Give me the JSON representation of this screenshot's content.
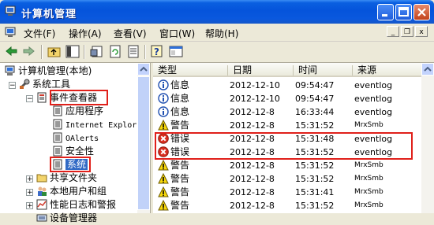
{
  "window": {
    "title": "计算机管理"
  },
  "menubar": {
    "items": [
      "文件(F)",
      "操作(A)",
      "查看(V)",
      "窗口(W)",
      "帮助(H)"
    ],
    "mdi_minimize": "_",
    "mdi_restore": "❐",
    "mdi_close": "x"
  },
  "toolbar": {
    "buttons": [
      "back-icon",
      "forward-icon",
      "up-folder-icon",
      "show-hide-tree-icon",
      "properties-icon",
      "refresh-icon",
      "export-list-icon",
      "help-icon",
      "console-icon"
    ]
  },
  "tree": {
    "items": [
      {
        "label": "计算机管理(本地)",
        "icon": "computer-icon"
      },
      {
        "label": "系统工具",
        "icon": "tools-icon"
      },
      {
        "label": "事件查看器",
        "icon": "event-viewer-icon"
      },
      {
        "label": "应用程序",
        "icon": "log-icon"
      },
      {
        "label": "Internet Explor",
        "icon": "log-icon"
      },
      {
        "label": "OAlerts",
        "icon": "log-icon"
      },
      {
        "label": "安全性",
        "icon": "log-icon"
      },
      {
        "label": "系统",
        "icon": "log-icon"
      },
      {
        "label": "共享文件夹",
        "icon": "folder-icon"
      },
      {
        "label": "本地用户和组",
        "icon": "users-icon"
      },
      {
        "label": "性能日志和警报",
        "icon": "perf-icon"
      },
      {
        "label": "设备管理器",
        "icon": "device-icon"
      }
    ]
  },
  "list": {
    "columns": [
      "类型",
      "日期",
      "时间",
      "来源"
    ],
    "rows": [
      {
        "type": "信息",
        "kind": "info",
        "date": "2012-12-10",
        "time": "09:54:47",
        "source": "eventlog"
      },
      {
        "type": "信息",
        "kind": "info",
        "date": "2012-12-10",
        "time": "09:54:47",
        "source": "eventlog"
      },
      {
        "type": "信息",
        "kind": "info",
        "date": "2012-12-8",
        "time": "16:33:44",
        "source": "eventlog"
      },
      {
        "type": "警告",
        "kind": "warning",
        "date": "2012-12-8",
        "time": "15:31:52",
        "source": "MrxSmb"
      },
      {
        "type": "错误",
        "kind": "error",
        "date": "2012-12-8",
        "time": "15:31:48",
        "source": "eventlog"
      },
      {
        "type": "错误",
        "kind": "error",
        "date": "2012-12-8",
        "time": "15:31:52",
        "source": "eventlog"
      },
      {
        "type": "警告",
        "kind": "warning",
        "date": "2012-12-8",
        "time": "15:31:52",
        "source": "MrxSmb"
      },
      {
        "type": "警告",
        "kind": "warning",
        "date": "2012-12-8",
        "time": "15:31:52",
        "source": "MrxSmb"
      },
      {
        "type": "警告",
        "kind": "warning",
        "date": "2012-12-8",
        "time": "15:31:41",
        "source": "MrxSmb"
      },
      {
        "type": "警告",
        "kind": "warning",
        "date": "2012-12-8",
        "time": "15:31:52",
        "source": "MrxSmb"
      }
    ]
  },
  "colors": {
    "title_bar": "#0554DB",
    "highlight": "#E0201A",
    "selection": "#316AC5"
  }
}
